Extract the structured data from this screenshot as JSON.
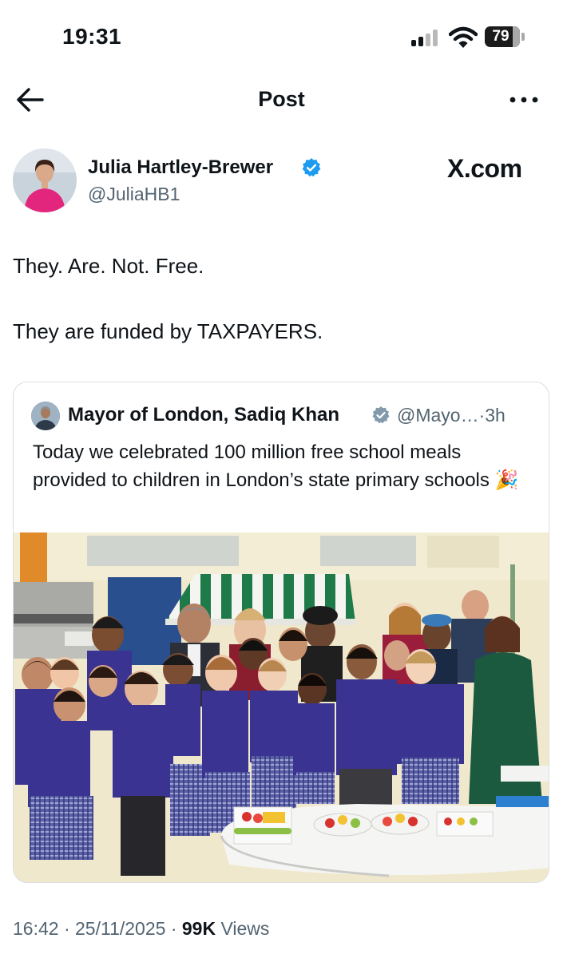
{
  "status_bar": {
    "time": "19:31",
    "battery": "79",
    "battery_fraction": 0.79
  },
  "nav": {
    "back_icon": "arrow-left-icon",
    "title": "Post",
    "more_icon": "more-horizontal-icon"
  },
  "author": {
    "name": "Julia Hartley-Brewer",
    "handle": "@JuliaHB1",
    "verified_icon": "verified-badge-icon",
    "verified_color": "#1d9bf0"
  },
  "source": "X.com",
  "post": {
    "line1": "They. Are. Not. Free.",
    "line2": "They are funded by TAXPAYERS."
  },
  "quote": {
    "name": "Mayor of London, Sadiq Khan",
    "handle": "@Mayo…",
    "age": "3h",
    "verified_icon": "verified-badge-gray-icon",
    "verified_color": "#829aab",
    "text": "Today we celebrated 100 million free school meals provided to children in London’s state primary schools",
    "emoji": "🎉",
    "photo_icon": "group-photo-school-children-icon"
  },
  "footer": {
    "time": "16:42",
    "date": "25/11/2025",
    "views_count": "99K",
    "views_label": "Views",
    "separator": "·"
  }
}
